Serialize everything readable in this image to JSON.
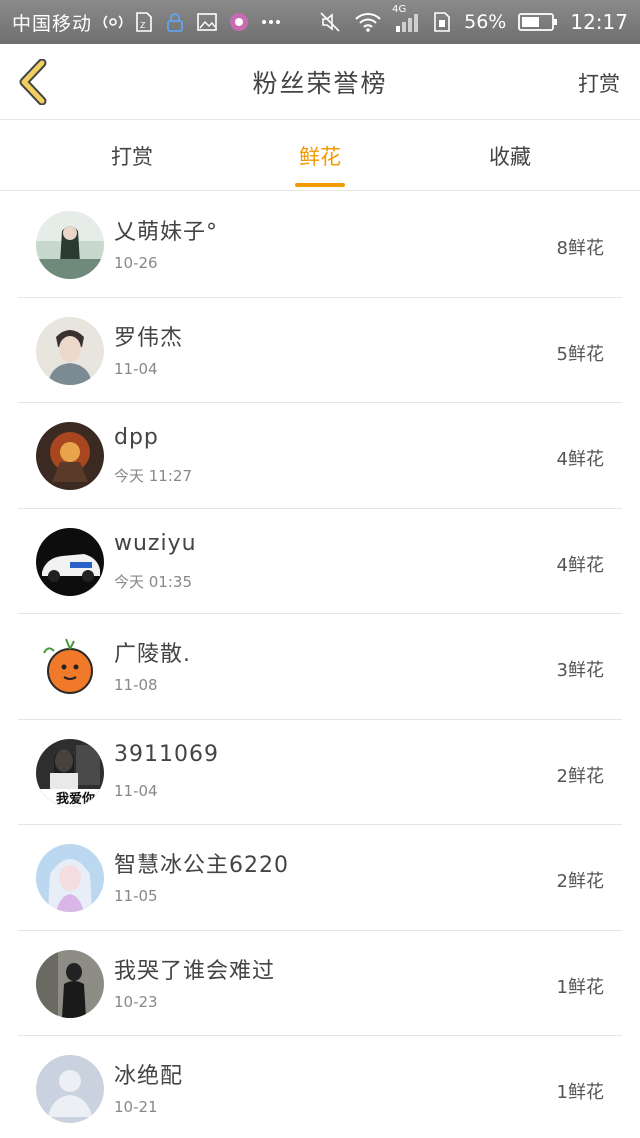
{
  "status_bar": {
    "carrier": "中国移动",
    "network_type": "4G",
    "battery": "56%",
    "time": "12:17"
  },
  "header": {
    "title": "粉丝荣誉榜",
    "action_label": "打赏"
  },
  "tabs": [
    {
      "label": "打赏",
      "active": false
    },
    {
      "label": "鲜花",
      "active": true
    },
    {
      "label": "收藏",
      "active": false
    }
  ],
  "accent_color": "#f09a00",
  "fans": [
    {
      "name": "乂萌妹子°",
      "date": "10-26",
      "count": "8鲜花",
      "avatar": "photo"
    },
    {
      "name": "罗伟杰",
      "date": "11-04",
      "count": "5鲜花",
      "avatar": "photo"
    },
    {
      "name": "dpp",
      "date": "今天 11:27",
      "count": "4鲜花",
      "avatar": "photo"
    },
    {
      "name": "wuziyu",
      "date": "今天 01:35",
      "count": "4鲜花",
      "avatar": "photo"
    },
    {
      "name": "广陵散.",
      "date": "11-08",
      "count": "3鲜花",
      "avatar": "cartoon-orange"
    },
    {
      "name": "3911069",
      "date": "11-04",
      "count": "2鲜花",
      "avatar": "photo",
      "avatar_text": "我爱你"
    },
    {
      "name": "智慧冰公主6220",
      "date": "11-05",
      "count": "2鲜花",
      "avatar": "photo"
    },
    {
      "name": "我哭了谁会难过",
      "date": "10-23",
      "count": "1鲜花",
      "avatar": "photo"
    },
    {
      "name": "冰绝配",
      "date": "10-21",
      "count": "1鲜花",
      "avatar": "default-user"
    }
  ]
}
